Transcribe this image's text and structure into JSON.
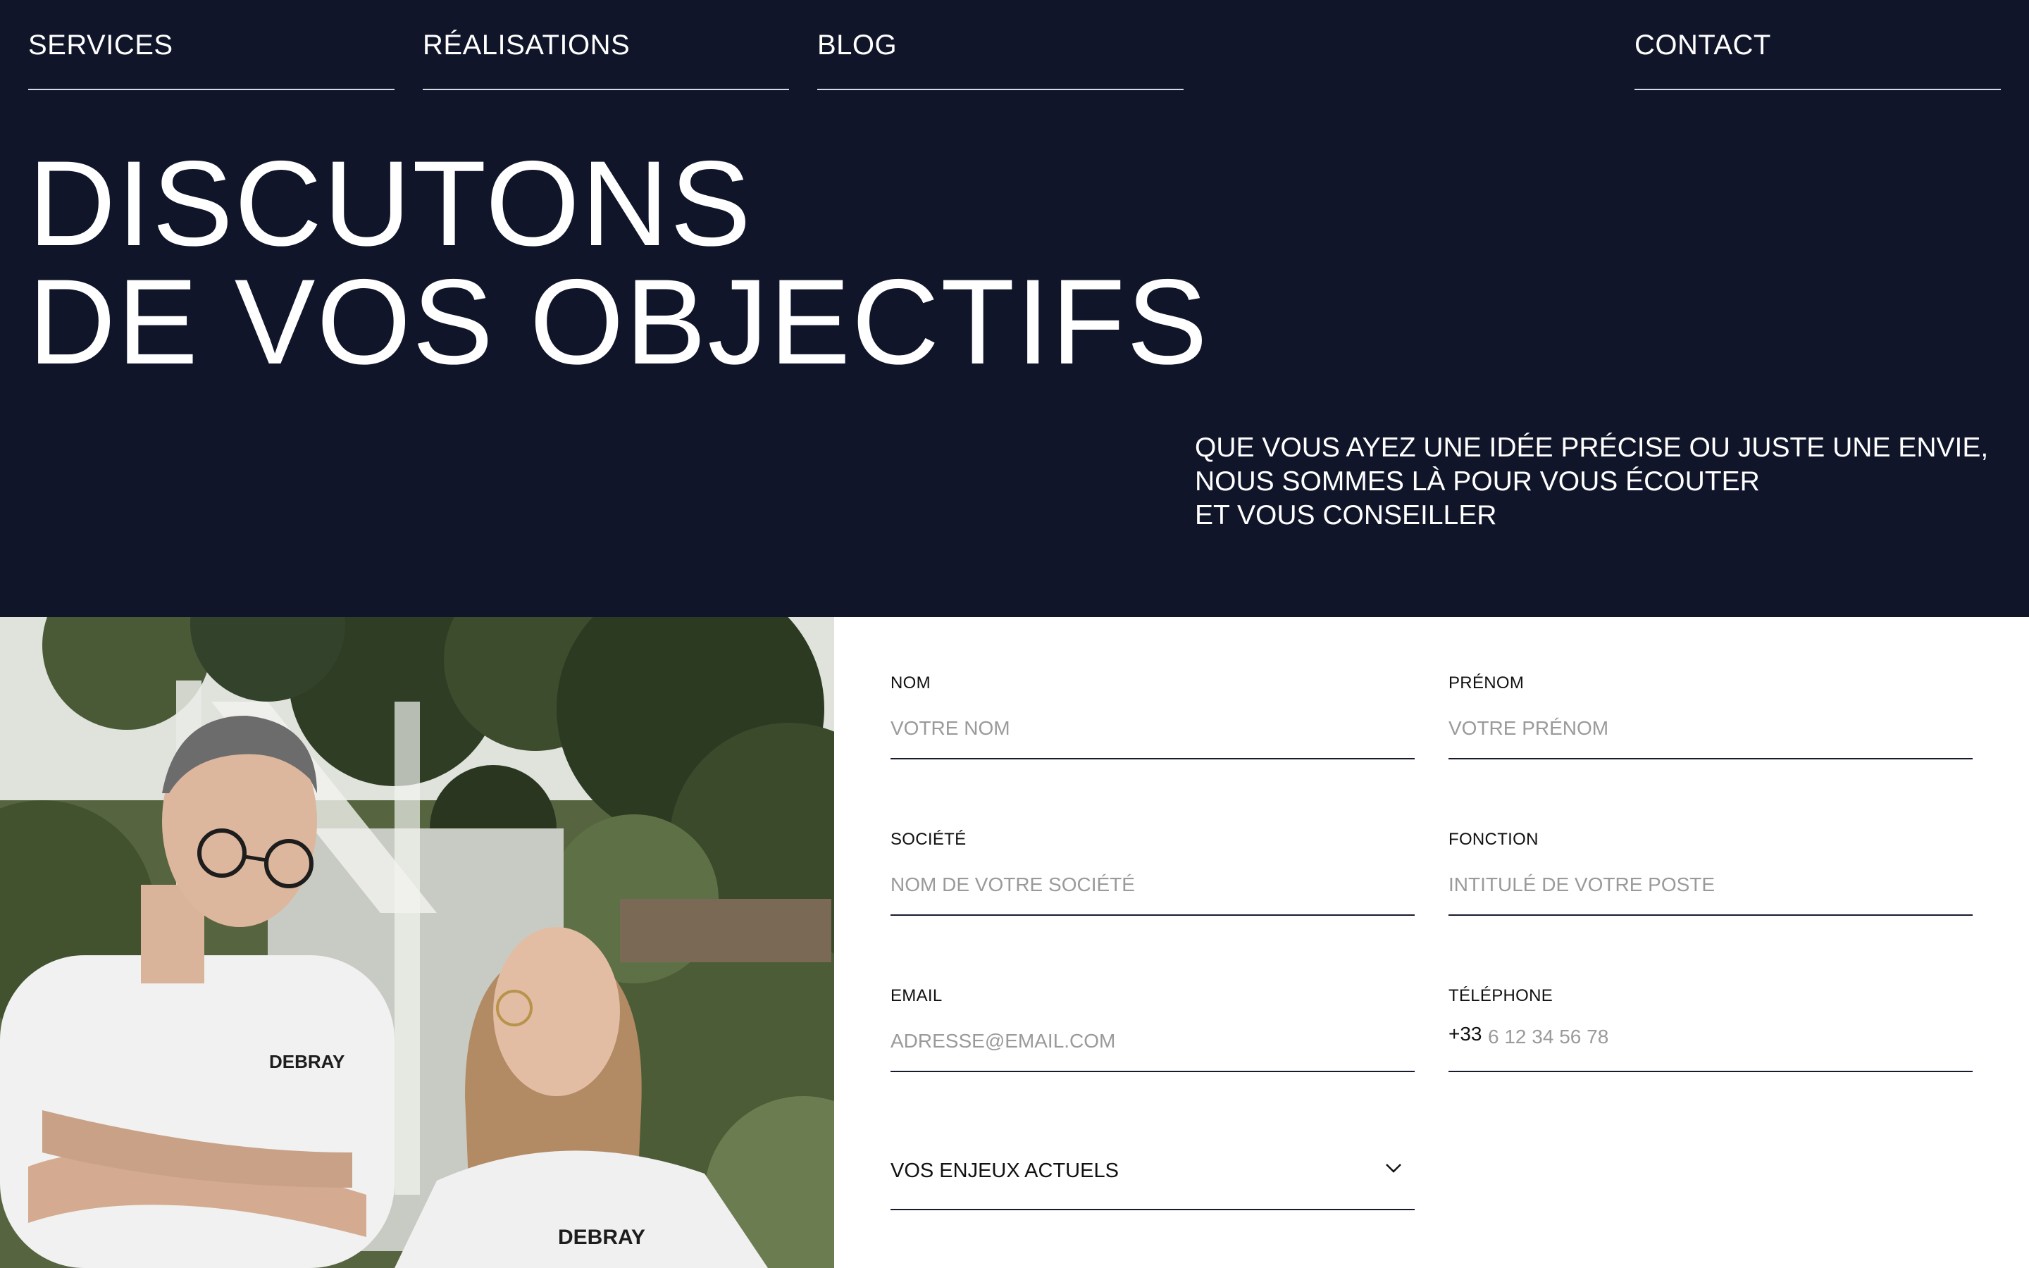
{
  "nav": {
    "services": "SERVICES",
    "realisations": "RÉALISATIONS",
    "blog": "BLOG",
    "contact": "CONTACT"
  },
  "hero": {
    "title_line1": "DISCUTONS",
    "title_line2": "DE VOS OBJECTIFS",
    "intro_line1": "QUE VOUS AYEZ UNE IDÉE PRÉCISE OU JUSTE UNE ENVIE,",
    "intro_line2": "NOUS SOMMES LÀ POUR VOUS ÉCOUTER",
    "intro_line3": "ET VOUS CONSEILLER"
  },
  "photo": {
    "shirt_brand": "DEBRAY"
  },
  "form": {
    "nom": {
      "label": "NOM",
      "placeholder": "VOTRE NOM",
      "value": ""
    },
    "prenom": {
      "label": "PRÉNOM",
      "placeholder": "VOTRE PRÉNOM",
      "value": ""
    },
    "societe": {
      "label": "SOCIÉTÉ",
      "placeholder": "NOM DE VOTRE SOCIÉTÉ",
      "value": ""
    },
    "fonction": {
      "label": "FONCTION",
      "placeholder": "INTITULÉ DE VOTRE POSTE",
      "value": ""
    },
    "email": {
      "label": "EMAIL",
      "placeholder": "ADRESSE@EMAIL.COM",
      "value": ""
    },
    "telephone": {
      "label": "TÉLÉPHONE",
      "prefix": "+33",
      "placeholder": "6 12 34 56 78",
      "value": ""
    },
    "enjeux": {
      "selected": "VOS ENJEUX ACTUELS",
      "icon": "chevron-down-icon"
    }
  },
  "colors": {
    "hero_background": "#10152a",
    "text_light": "#ffffff",
    "placeholder": "#9a9a9a",
    "underline": "#161b2e"
  }
}
